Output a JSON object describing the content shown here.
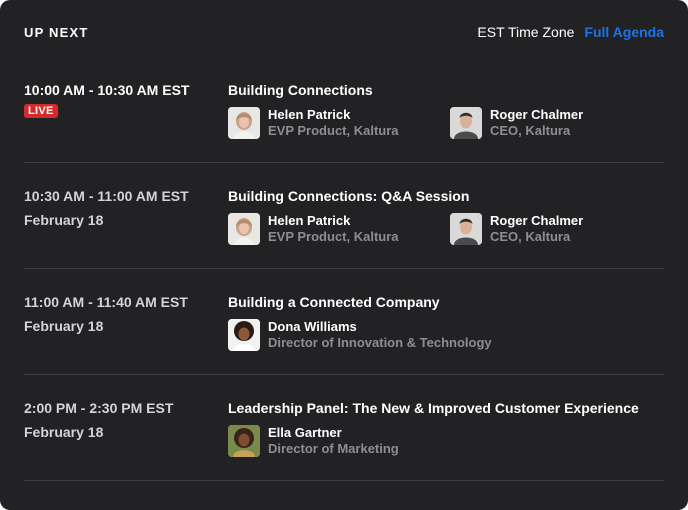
{
  "header": {
    "title": "UP NEXT",
    "timezone": "EST Time Zone",
    "agenda_link": "Full Agenda"
  },
  "colors": {
    "background": "#222224",
    "accent_link": "#1a73e8",
    "live_badge": "#d42a2a",
    "divider": "#3e3e41",
    "muted_text": "#8e8e92"
  },
  "sessions": [
    {
      "time": "10:00 AM - 10:30 AM EST",
      "badge": "LIVE",
      "title": "Building Connections",
      "speakers": [
        {
          "name": "Helen Patrick",
          "role": "EVP Product, Kaltura",
          "avatar": "woman-portrait"
        },
        {
          "name": "Roger Chalmer",
          "role": "CEO, Kaltura",
          "avatar": "man-portrait"
        }
      ]
    },
    {
      "time": "10:30 AM - 11:00 AM EST",
      "date": "February 18",
      "title": "Building Connections: Q&A Session",
      "speakers": [
        {
          "name": "Helen Patrick",
          "role": "EVP Product, Kaltura",
          "avatar": "woman-portrait"
        },
        {
          "name": "Roger Chalmer",
          "role": "CEO, Kaltura",
          "avatar": "man-portrait"
        }
      ]
    },
    {
      "time": "11:00 AM - 11:40 AM EST",
      "date": "February 18",
      "title": "Building a Connected Company",
      "speakers": [
        {
          "name": "Dona Williams",
          "role": "Director of Innovation & Technology",
          "avatar": "woman-curly-portrait"
        }
      ]
    },
    {
      "time": "2:00 PM - 2:30 PM EST",
      "date": "February 18",
      "title": "Leadership Panel: The New & Improved Customer Experience",
      "speakers": [
        {
          "name": "Ella Gartner",
          "role": "Director of Marketing",
          "avatar": "woman-outdoor-portrait"
        }
      ]
    }
  ]
}
